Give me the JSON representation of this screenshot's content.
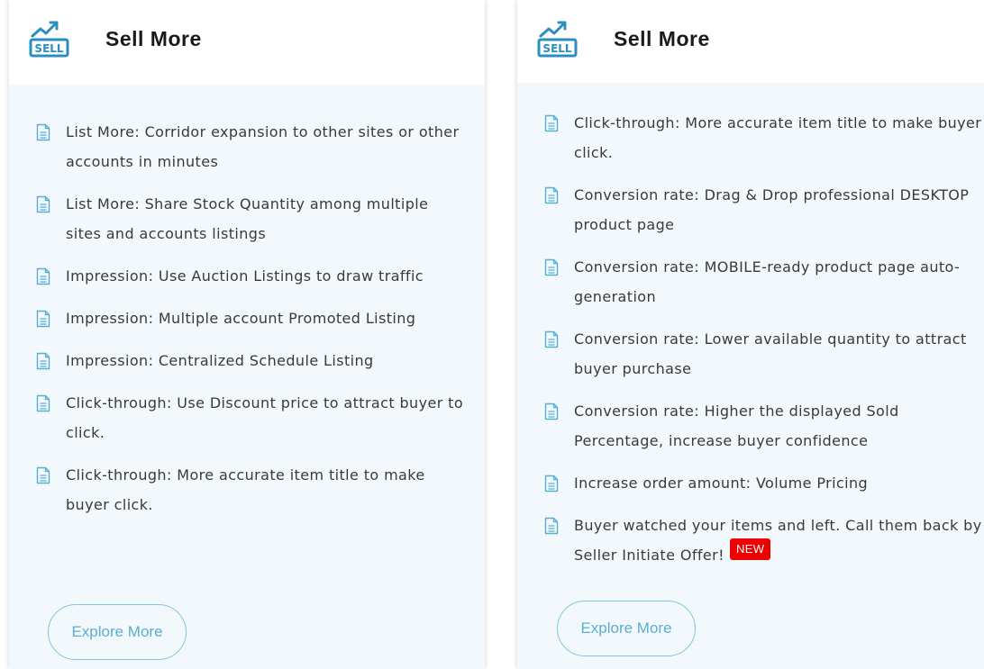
{
  "cards": [
    {
      "logo_text": "SELL",
      "title": "Sell More",
      "items": [
        "List More: Corridor expansion to other sites or other accounts in minutes",
        "List More: Share Stock Quantity among multiple sites and accounts listings",
        "Impression: Use Auction Listings to draw traffic",
        "Impression: Multiple account Promoted Listing",
        "Impression: Centralized Schedule Listing",
        "Click-through: Use Discount price to attract buyer to click.",
        "Click-through: More accurate item title to make buyer click."
      ],
      "button_label": "Explore More"
    },
    {
      "logo_text": "SELL",
      "title": "Sell More",
      "items": [
        "Click-through: More accurate item title to make buyer click.",
        "Conversion rate: Drag & Drop professional DESKTOP product page",
        "Conversion rate: MOBILE-ready product page auto-generation",
        "Conversion rate: Lower available quantity to attract buyer purchase",
        "Conversion rate: Higher the displayed Sold Percentage, increase buyer confidence",
        "Increase order amount: Volume Pricing",
        "Buyer watched your items and left. Call them back by Seller Initiate Offer!"
      ],
      "new_badge": "NEW",
      "button_label": "Explore More"
    }
  ],
  "colors": {
    "accent": "#5aaed1",
    "card_bg": "#f2f8fb",
    "badge": "#ee0000"
  },
  "icons": {
    "logo": "sell-chart-icon",
    "bullet": "document-icon"
  }
}
